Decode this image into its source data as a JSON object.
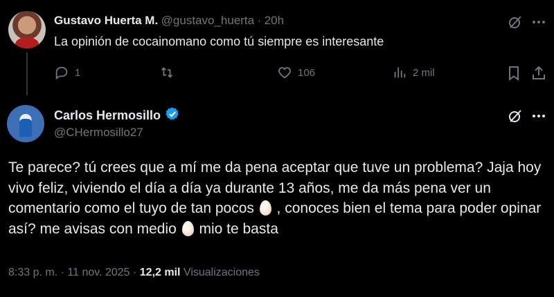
{
  "reply": {
    "author_name": "Gustavo Huerta M.",
    "handle": "@gustavo_huerta",
    "separator": "·",
    "time": "20h",
    "text": "La opinión de cocainomano como tú siempre es interesante",
    "actions": {
      "replies": "1",
      "reposts": "",
      "likes": "106",
      "views": "2 mil"
    },
    "icons": [
      "grok-icon",
      "more-icon",
      "reply-icon",
      "repost-icon",
      "like-icon",
      "views-icon",
      "bookmark-icon",
      "share-icon"
    ]
  },
  "main": {
    "author_name": "Carlos Hermosillo",
    "handle": "@CHermosillo27",
    "verified": true,
    "text_parts": {
      "p1": "Te parece? tú crees que a mí me da pena aceptar que tuve un problema? Jaja  hoy vivo feliz, viviendo el día a día ya durante 13 años, me da más pena ver un comentario como el tuyo de tan pocos",
      "p2": " ,  conoces  bien el tema para poder opinar así? me avisas con medio",
      "p3": " mio te basta"
    },
    "emoji": "egg",
    "footer": {
      "time": "8:33 p. m.",
      "dot1": "·",
      "date": "11 nov. 2025",
      "dot2": "·",
      "views_count": "12,2 mil",
      "views_label": "Visualizaciones"
    }
  },
  "colors": {
    "background": "#000000",
    "text": "#e7e9ea",
    "muted": "#71767b",
    "verified": "#1d9bf0",
    "divider": "#2f3336"
  }
}
